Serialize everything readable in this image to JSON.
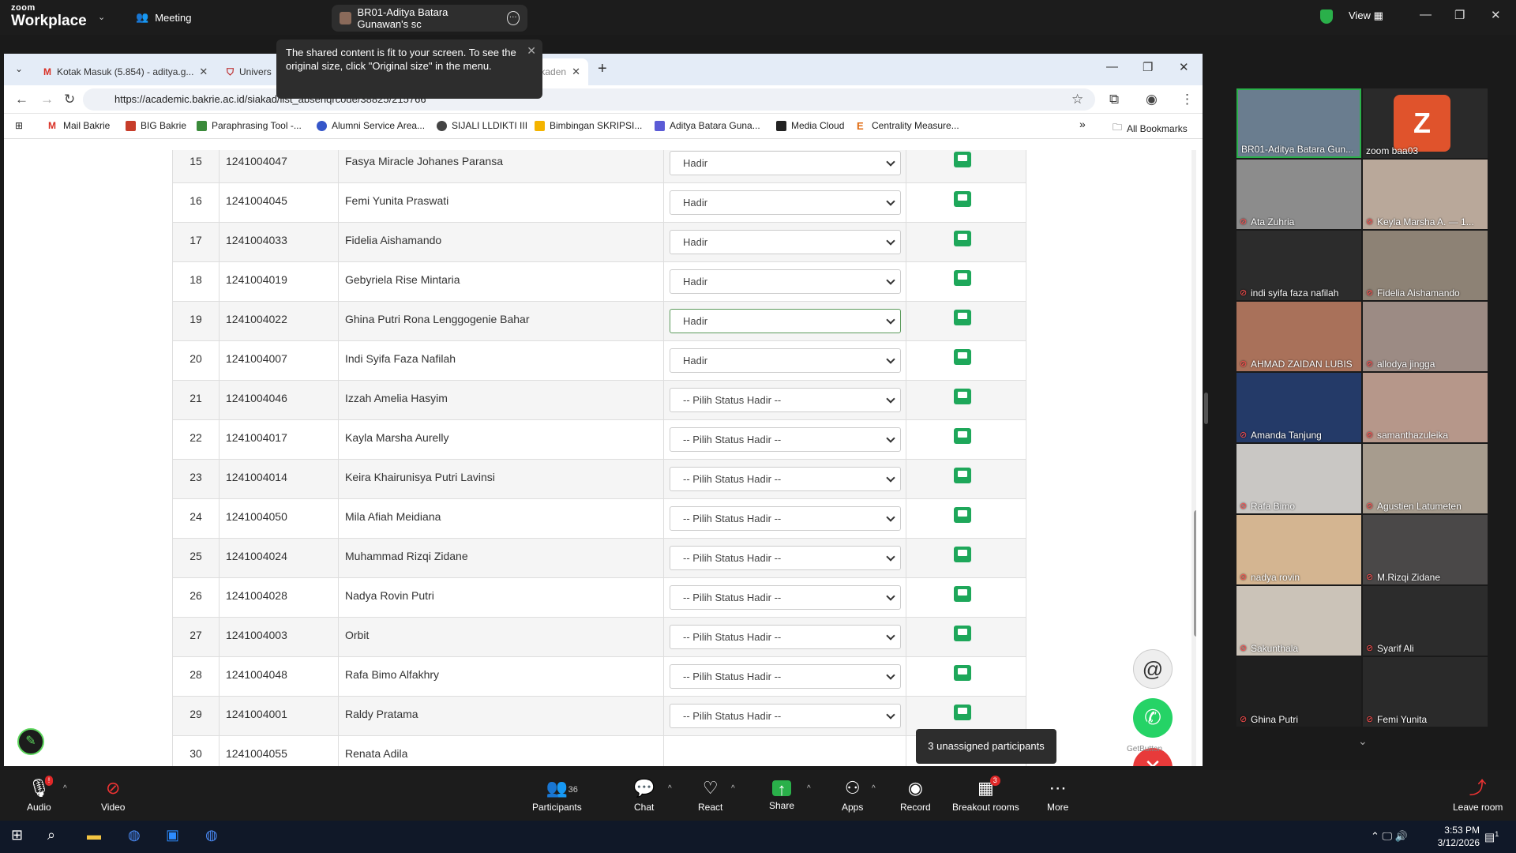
{
  "zoom": {
    "logo_top": "zoom",
    "logo_bottom": "Workplace",
    "meeting": "Meeting",
    "share_tab": "BR01-Aditya Batara Gunawan's sc",
    "view": "View"
  },
  "toast": {
    "line1": "The shared content is fit to your screen. To see the",
    "line2": "original size, click \"Original size\" in the menu."
  },
  "browser": {
    "tab1": "Kotak Masuk (5.854) - aditya.g...",
    "tab2": "Univers",
    "tab3": "- SIM Akaden",
    "url": "https://academic.bakrie.ac.id/siakad/list_absenqrcode/38825/215766",
    "bookmarks": [
      "Mail Bakrie",
      "BIG Bakrie",
      "Paraphrasing Tool -...",
      "Alumni Service Area...",
      "SIJALI LLDIKTI III",
      "Bimbingan SKRIPSI...",
      "Aditya Batara Guna...",
      "Media Cloud",
      "Centrality Measure..."
    ],
    "more_bookmarks": "»",
    "all_bookmarks": "All Bookmarks"
  },
  "students": [
    {
      "no": "15",
      "nim": "1241004047",
      "name": "Fasya Miracle Johanes Paransa",
      "status": "Hadir"
    },
    {
      "no": "16",
      "nim": "1241004045",
      "name": "Femi Yunita Praswati",
      "status": "Hadir"
    },
    {
      "no": "17",
      "nim": "1241004033",
      "name": "Fidelia Aishamando",
      "status": "Hadir"
    },
    {
      "no": "18",
      "nim": "1241004019",
      "name": "Gebyriela Rise Mintaria",
      "status": "Hadir"
    },
    {
      "no": "19",
      "nim": "1241004022",
      "name": "Ghina Putri Rona Lenggogenie Bahar",
      "status": "Hadir"
    },
    {
      "no": "20",
      "nim": "1241004007",
      "name": "Indi Syifa Faza Nafilah",
      "status": "Hadir"
    },
    {
      "no": "21",
      "nim": "1241004046",
      "name": "Izzah Amelia Hasyim",
      "status": "-- Pilih Status Hadir --"
    },
    {
      "no": "22",
      "nim": "1241004017",
      "name": "Kayla Marsha Aurelly",
      "status": "-- Pilih Status Hadir --"
    },
    {
      "no": "23",
      "nim": "1241004014",
      "name": "Keira Khairunisya Putri Lavinsi",
      "status": "-- Pilih Status Hadir --"
    },
    {
      "no": "24",
      "nim": "1241004050",
      "name": "Mila Afiah Meidiana",
      "status": "-- Pilih Status Hadir --"
    },
    {
      "no": "25",
      "nim": "1241004024",
      "name": "Muhammad Rizqi Zidane",
      "status": "-- Pilih Status Hadir --"
    },
    {
      "no": "26",
      "nim": "1241004028",
      "name": "Nadya Rovin Putri",
      "status": "-- Pilih Status Hadir --"
    },
    {
      "no": "27",
      "nim": "1241004003",
      "name": "Orbit",
      "status": "-- Pilih Status Hadir --"
    },
    {
      "no": "28",
      "nim": "1241004048",
      "name": "Rafa Bimo Alfakhry",
      "status": "-- Pilih Status Hadir --"
    },
    {
      "no": "29",
      "nim": "1241004001",
      "name": "Raldy Pratama",
      "status": "-- Pilih Status Hadir --"
    },
    {
      "no": "30",
      "nim": "1241004055",
      "name": "Renata Adila",
      "status": ""
    }
  ],
  "getbutton": "GetButton",
  "unassigned": "3 unassigned participants",
  "participants_gallery": [
    {
      "name": "BR01-Aditya Batara Gun...",
      "color": "#6a7d8f"
    },
    {
      "name": "zoom baa03",
      "color": "#2a2a2a",
      "initial": "Z"
    },
    {
      "name": "Ata Zuhria",
      "color": "#8c8c8c"
    },
    {
      "name": "Keyla Marsha A. — 1...",
      "color": "#b9a89a"
    },
    {
      "name": "indi syifa faza nafilah",
      "color": "#2c2c2c"
    },
    {
      "name": "Fidelia Aishamando",
      "color": "#8d8275"
    },
    {
      "name": "AHMAD ZAIDAN LUBIS",
      "color": "#a9715a"
    },
    {
      "name": "allodya jingga",
      "color": "#9c8b84"
    },
    {
      "name": "Amanda Tanjung",
      "color": "#243a68"
    },
    {
      "name": "samanthazuleika",
      "color": "#b6978a"
    },
    {
      "name": "Rafa Bimo",
      "color": "#c9c7c4"
    },
    {
      "name": "Agustien Latumeten",
      "color": "#a79c8e"
    },
    {
      "name": "nadya rovin",
      "color": "#d4b591"
    },
    {
      "name": "M.Rizqi Zidane",
      "color": "#4a4848"
    },
    {
      "name": "Sakunthala",
      "color": "#cbc3b8"
    },
    {
      "name": "Syarif Ali",
      "color": "#2c2c2c"
    },
    {
      "name": "Ghina Putri",
      "color": "#1f1f1f"
    },
    {
      "name": "Femi Yunita",
      "color": "#2a2a2a"
    }
  ],
  "controls": {
    "audio": "Audio",
    "video": "Video",
    "participants": "Participants",
    "participants_count": "36",
    "chat": "Chat",
    "react": "React",
    "share": "Share",
    "apps": "Apps",
    "record": "Record",
    "breakout": "Breakout rooms",
    "breakout_badge": "3",
    "more": "More",
    "leave": "Leave room"
  },
  "taskbar": {
    "time": "3:53 PM",
    "date": "3/12/2026",
    "notif": "1"
  }
}
